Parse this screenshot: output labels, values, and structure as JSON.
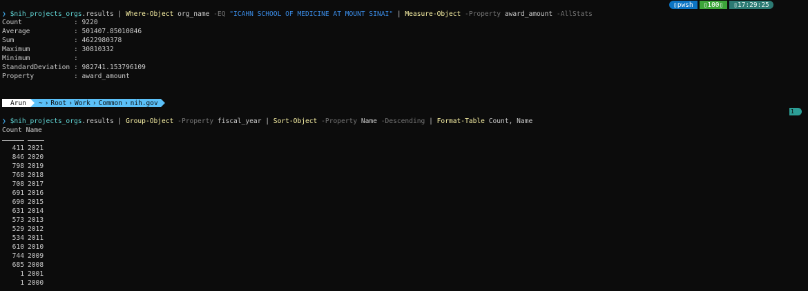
{
  "command1": {
    "prompt": "❯",
    "var": "$nih_projects_orgs",
    "prop": ".results",
    "pipe1": " | ",
    "cmd1": "Where-Object",
    "arg1": " org_name ",
    "param1": "-EQ",
    "str1": " \"ICAHN SCHOOL OF MEDICINE AT MOUNT SINAI\"",
    "pipe2": " | ",
    "cmd2": "Measure-Object",
    "param2": " -Property",
    "arg2": " award_amount ",
    "param3": "-AllStats"
  },
  "status": {
    "shell": "pwsh",
    "exit": "100",
    "time": "17:29:25",
    "colors": {
      "pwsh": "#0b74c4",
      "ok": "#3da53a",
      "time": "#2c7a73"
    }
  },
  "stats": [
    {
      "label": "Count            ",
      "value": ": 9220"
    },
    {
      "label": "Average          ",
      "value": ": 501407.85010846"
    },
    {
      "label": "Sum              ",
      "value": ": 4622980378"
    },
    {
      "label": "Maximum          ",
      "value": ": 30810332"
    },
    {
      "label": "Minimum          ",
      "value": ":"
    },
    {
      "label": "StandardDeviation",
      "value": " : 982741.153796109"
    },
    {
      "label": "Property         ",
      "value": ": award_amount"
    }
  ],
  "powerline": {
    "user": "Arun",
    "path": [
      "~",
      "Root",
      "Work",
      "Common",
      "nih.gov"
    ]
  },
  "command2": {
    "prompt": "❯",
    "var": "$nih_projects_orgs",
    "prop": ".results",
    "pipe1": " | ",
    "cmd1": "Group-Object",
    "param1": " -Property",
    "arg1": " fiscal_year",
    "pipe2": " | ",
    "cmd2": "Sort-Object",
    "param2": " -Property",
    "arg2": " Name ",
    "param3": "-Descending",
    "pipe3": " | ",
    "cmd3": "Format-Table",
    "arg3": " Count, Name"
  },
  "mini_badge": "1",
  "table": {
    "headers": [
      "Count",
      "Name"
    ],
    "rows": [
      [
        "411",
        "2021"
      ],
      [
        "846",
        "2020"
      ],
      [
        "798",
        "2019"
      ],
      [
        "768",
        "2018"
      ],
      [
        "708",
        "2017"
      ],
      [
        "691",
        "2016"
      ],
      [
        "690",
        "2015"
      ],
      [
        "631",
        "2014"
      ],
      [
        "573",
        "2013"
      ],
      [
        "529",
        "2012"
      ],
      [
        "534",
        "2011"
      ],
      [
        "610",
        "2010"
      ],
      [
        "744",
        "2009"
      ],
      [
        "685",
        "2008"
      ],
      [
        "1",
        "2001"
      ],
      [
        "1",
        "2000"
      ]
    ]
  }
}
